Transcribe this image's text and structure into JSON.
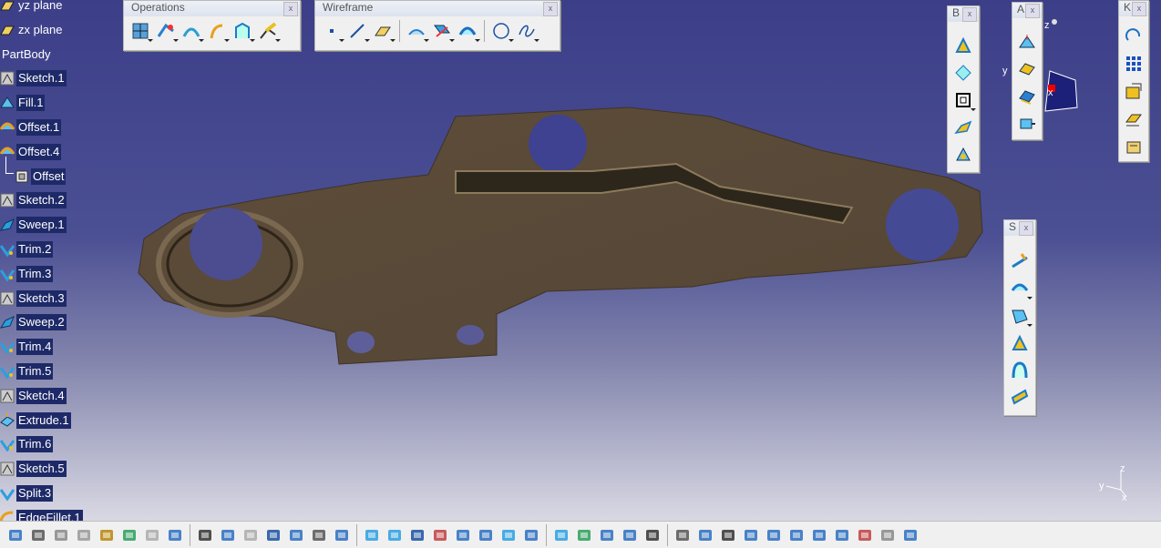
{
  "tree": {
    "items": [
      {
        "label": "yz plane",
        "icon": "plane-icon"
      },
      {
        "label": "zx plane",
        "icon": "plane-icon"
      },
      {
        "label": "PartBody",
        "icon": "none"
      },
      {
        "label": "Sketch.1",
        "icon": "sketch-icon"
      },
      {
        "label": "Fill.1",
        "icon": "fill-icon"
      },
      {
        "label": "Offset.1",
        "icon": "offset-icon"
      },
      {
        "label": "Offset.4",
        "icon": "offset-icon"
      },
      {
        "label": "Offset",
        "icon": "offset-solid-icon"
      },
      {
        "label": "Sketch.2",
        "icon": "sketch-icon"
      },
      {
        "label": "Sweep.1",
        "icon": "sweep-icon"
      },
      {
        "label": "Trim.2",
        "icon": "trim-icon"
      },
      {
        "label": "Trim.3",
        "icon": "trim-icon"
      },
      {
        "label": "Sketch.3",
        "icon": "sketch-icon"
      },
      {
        "label": "Sweep.2",
        "icon": "sweep-icon"
      },
      {
        "label": "Trim.4",
        "icon": "trim-icon"
      },
      {
        "label": "Trim.5",
        "icon": "trim-icon"
      },
      {
        "label": "Sketch.4",
        "icon": "sketch-icon"
      },
      {
        "label": "Extrude.1",
        "icon": "extrude-icon"
      },
      {
        "label": "Trim.6",
        "icon": "trim-icon"
      },
      {
        "label": "Sketch.5",
        "icon": "sketch-icon"
      },
      {
        "label": "Split.3",
        "icon": "split-icon"
      },
      {
        "label": "EdgeFillet.1",
        "icon": "fillet-icon"
      }
    ]
  },
  "toolbars": {
    "operations": {
      "title": "Operations",
      "close": "x"
    },
    "wireframe": {
      "title": "Wireframe",
      "close": "x"
    },
    "b": {
      "title": "B",
      "close": "x"
    },
    "a": {
      "title": "A",
      "close": "x"
    },
    "s": {
      "title": "S",
      "close": "x"
    },
    "k": {
      "title": "K",
      "close": "x"
    }
  },
  "compass": {
    "z": "z",
    "y": "y",
    "x": "x"
  },
  "triad": {
    "z": "z",
    "y": "y",
    "x": "x"
  },
  "bottom_icons": [
    "save-icon",
    "print-icon",
    "cut-icon",
    "copy-icon",
    "paste-icon",
    "undo-icon",
    "redo-icon",
    "whats-this-icon",
    "formula-icon",
    "comment-icon",
    "knowledge-icon",
    "table-icon",
    "tree-icon",
    "lock-icon",
    "parameter-icon",
    "fly-icon",
    "fit-all-icon",
    "pan-icon",
    "rotate-icon",
    "zoom-in-icon",
    "zoom-out-icon",
    "normal-view-icon",
    "multi-view-icon",
    "iso-view-icon",
    "render-style-icon",
    "hide-show-icon",
    "swap-icon",
    "capture-icon",
    "snapshot-icon",
    "refresh-icon",
    "hand-icon",
    "axis-icon",
    "compare-icon",
    "grid-icon",
    "sweep-tool-icon",
    "face-icon",
    "measure-icon",
    "tools-icon",
    "settings-icon"
  ],
  "colors": {
    "viewport_top": "#3c3f88",
    "part": "#5c4c38"
  }
}
